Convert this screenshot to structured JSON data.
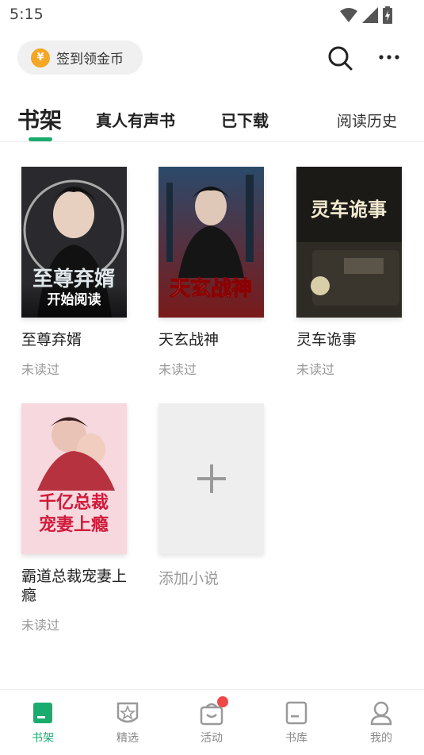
{
  "status_bar": {
    "time": "5:15"
  },
  "header": {
    "checkin_label": "签到领金币",
    "coin_symbol": "¥"
  },
  "tabs": {
    "bookshelf": "书架",
    "audio_books": "真人有声书",
    "downloaded": "已下载",
    "history": "阅读历史"
  },
  "books": [
    {
      "title": "至尊弃婿",
      "status": "未读过",
      "cover_text": "至尊弃婿",
      "action": "开始阅读"
    },
    {
      "title": "天玄战神",
      "status": "未读过",
      "cover_text": "天玄战神"
    },
    {
      "title": "灵车诡事",
      "status": "未读过",
      "cover_text": "灵车诡事"
    },
    {
      "title": "霸道总裁宠妻上瘾",
      "status": "未读过",
      "cover_text": "千亿总裁宠妻上瘾"
    }
  ],
  "add_novel": {
    "label": "添加小说"
  },
  "bottom_nav": [
    {
      "label": "书架",
      "icon": "bookshelf-icon",
      "active": true
    },
    {
      "label": "精选",
      "icon": "star-badge-icon"
    },
    {
      "label": "活动",
      "icon": "gift-bag-icon",
      "badge": true
    },
    {
      "label": "书库",
      "icon": "library-icon"
    },
    {
      "label": "我的",
      "icon": "profile-icon"
    }
  ],
  "colors": {
    "accent": "#1aab6f",
    "coin": "#f5a623",
    "badge": "#f04848"
  }
}
